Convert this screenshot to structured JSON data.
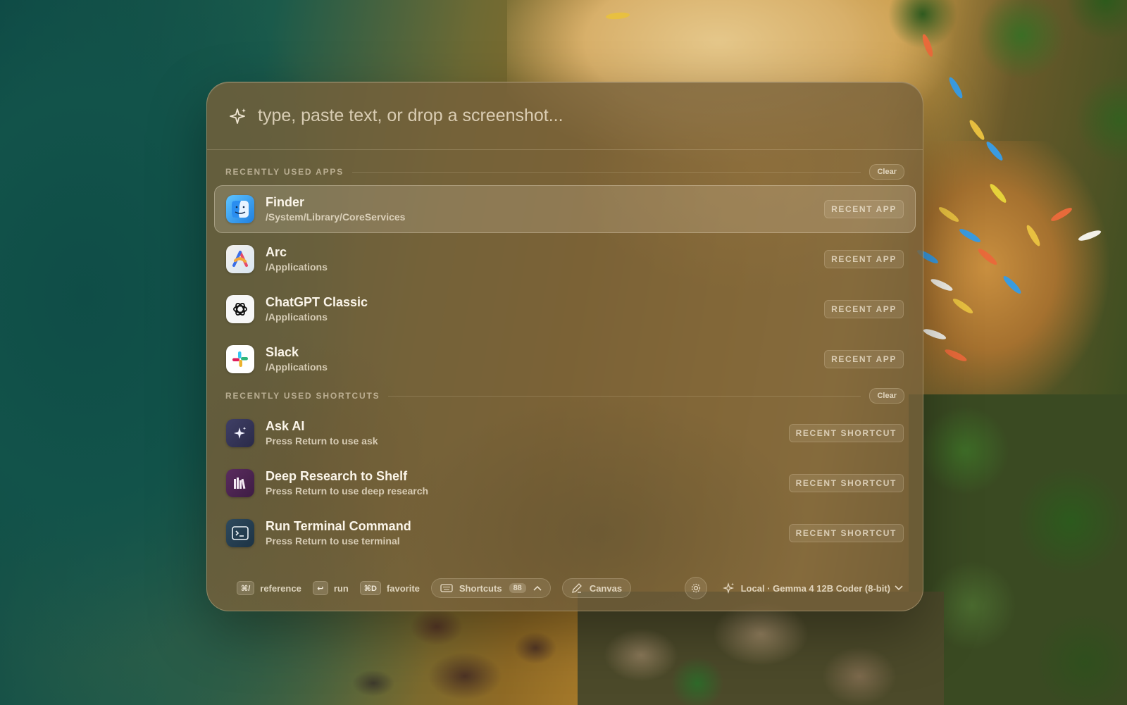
{
  "search": {
    "placeholder": "type, paste text, or drop a screenshot..."
  },
  "sections": {
    "apps": {
      "title": "RECENTLY USED APPS",
      "clear_label": "Clear",
      "items": [
        {
          "title": "Finder",
          "subtitle": "/System/Library/CoreServices",
          "tag": "RECENT APP",
          "icon": "finder-icon",
          "selected": true
        },
        {
          "title": "Arc",
          "subtitle": "/Applications",
          "tag": "RECENT APP",
          "icon": "arc-icon"
        },
        {
          "title": "ChatGPT Classic",
          "subtitle": "/Applications",
          "tag": "RECENT APP",
          "icon": "chatgpt-icon"
        },
        {
          "title": "Slack",
          "subtitle": "/Applications",
          "tag": "RECENT APP",
          "icon": "slack-icon"
        }
      ]
    },
    "shortcuts": {
      "title": "RECENTLY USED SHORTCUTS",
      "clear_label": "Clear",
      "items": [
        {
          "title": "Ask AI",
          "subtitle": "Press Return to use ask",
          "tag": "RECENT SHORTCUT",
          "icon": "sparkle-icon"
        },
        {
          "title": "Deep Research to Shelf",
          "subtitle": "Press Return to use deep research",
          "tag": "RECENT SHORTCUT",
          "icon": "books-icon"
        },
        {
          "title": "Run Terminal Command",
          "subtitle": "Press Return to use terminal",
          "tag": "RECENT SHORTCUT",
          "icon": "terminal-icon"
        }
      ]
    }
  },
  "footer": {
    "reference": {
      "key": "⌘/",
      "label": "reference"
    },
    "run": {
      "key": "↩",
      "label": "run"
    },
    "favorite": {
      "key": "⌘D",
      "label": "favorite"
    },
    "shortcuts": {
      "label": "Shortcuts",
      "count": "88"
    },
    "canvas": {
      "label": "Canvas"
    },
    "model": {
      "label": "Local · Gemma 4 12B Coder (8-bit)"
    }
  },
  "colors": {
    "panel_bg": "#76603a",
    "text_primary": "#fbf5e9",
    "accent_blue": "#2f8fe8"
  }
}
